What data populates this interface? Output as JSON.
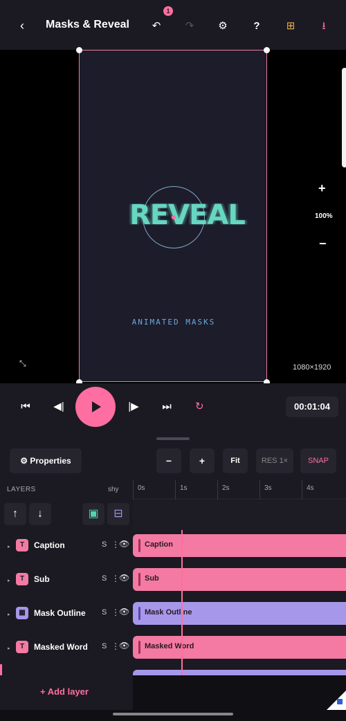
{
  "header": {
    "back_icon": "chevron-left-icon",
    "title": "Masks & Reveal",
    "undo_badge": "1",
    "icons": [
      "undo-icon",
      "redo-icon",
      "gear-icon",
      "help-icon",
      "grid-icon",
      "download-icon"
    ]
  },
  "canvas": {
    "reveal_text": "REVEAL",
    "subtitle_text": "ANIMATED MASKS",
    "dimensions": "1080×1920",
    "zoom_in": "+",
    "zoom_level": "100%",
    "zoom_out": "−",
    "colors": {
      "accent": "#ff6ea0",
      "reveal_text": "#67d6c2",
      "subtitle": "#6ea9d8"
    }
  },
  "transport": {
    "timecode": "00:01:04",
    "icons": [
      "skip-back-icon",
      "step-back-icon",
      "play-icon",
      "step-forward-icon",
      "skip-forward-icon",
      "loop-icon"
    ]
  },
  "toolbar": {
    "properties_label": "⚙ Properties",
    "minus_label": "−",
    "plus_label": "+",
    "fit_label": "Fit",
    "res_label": "RES 1×",
    "snap_label": "SNAP"
  },
  "layers": {
    "header_label": "LAYERS",
    "shy_label": "shy",
    "ruler_ticks": [
      "0s",
      "1s",
      "2s",
      "3s",
      "4s"
    ],
    "items": [
      {
        "name": "Caption",
        "type_glyph": "T",
        "solo": "S",
        "clip_label": "Caption"
      },
      {
        "name": "Sub",
        "type_glyph": "T",
        "solo": "S",
        "clip_label": "Sub"
      },
      {
        "name": "Mask Outline",
        "type_glyph": "▦",
        "solo": "S",
        "clip_label": "Mask Outline"
      },
      {
        "name": "Masked Word",
        "type_glyph": "T",
        "solo": "S",
        "clip_label": "Masked Word"
      }
    ],
    "add_layer_label": "+ Add layer"
  }
}
